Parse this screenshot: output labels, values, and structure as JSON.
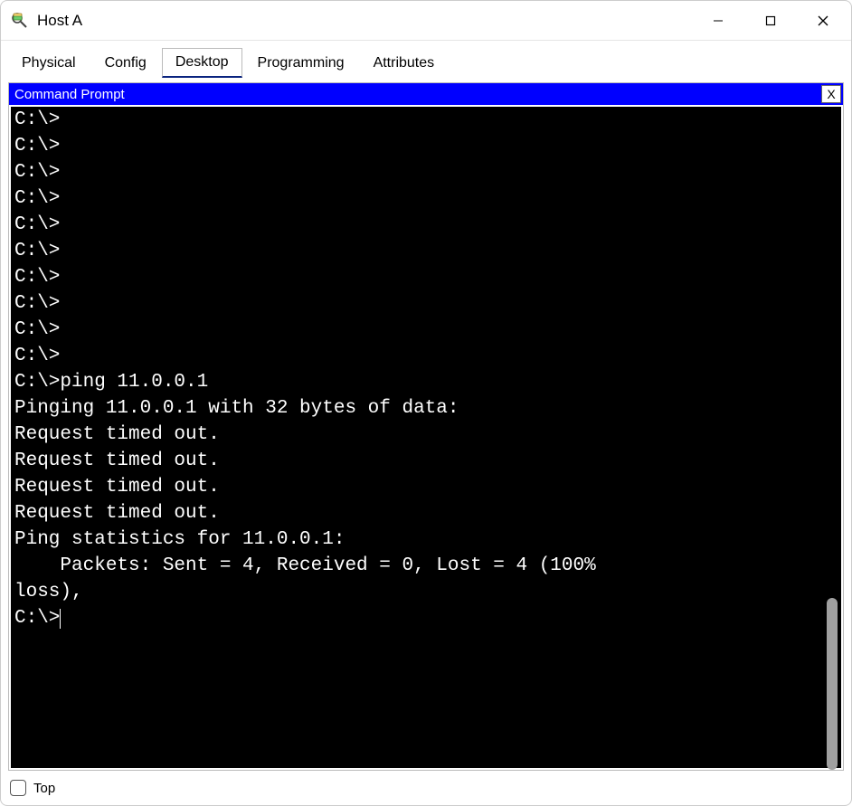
{
  "window": {
    "title": "Host A",
    "controls": {
      "minimize": "minimize-icon",
      "maximize": "maximize-icon",
      "close": "close-icon"
    }
  },
  "tabs": [
    {
      "label": "Physical",
      "active": false
    },
    {
      "label": "Config",
      "active": false
    },
    {
      "label": "Desktop",
      "active": true
    },
    {
      "label": "Programming",
      "active": false
    },
    {
      "label": "Attributes",
      "active": false
    }
  ],
  "panel": {
    "title": "Command Prompt",
    "close_label": "X"
  },
  "terminal": {
    "lines": [
      "C:\\>",
      "C:\\>",
      "C:\\>",
      "C:\\>",
      "C:\\>",
      "C:\\>",
      "C:\\>",
      "C:\\>",
      "C:\\>",
      "C:\\>",
      "C:\\>ping 11.0.0.1",
      "",
      "Pinging 11.0.0.1 with 32 bytes of data:",
      "",
      "Request timed out.",
      "Request timed out.",
      "Request timed out.",
      "Request timed out.",
      "",
      "Ping statistics for 11.0.0.1:",
      "    Packets: Sent = 4, Received = 0, Lost = 4 (100%",
      "loss),",
      "",
      "C:\\>"
    ]
  },
  "bottom": {
    "top_label": "Top",
    "top_checked": false
  }
}
